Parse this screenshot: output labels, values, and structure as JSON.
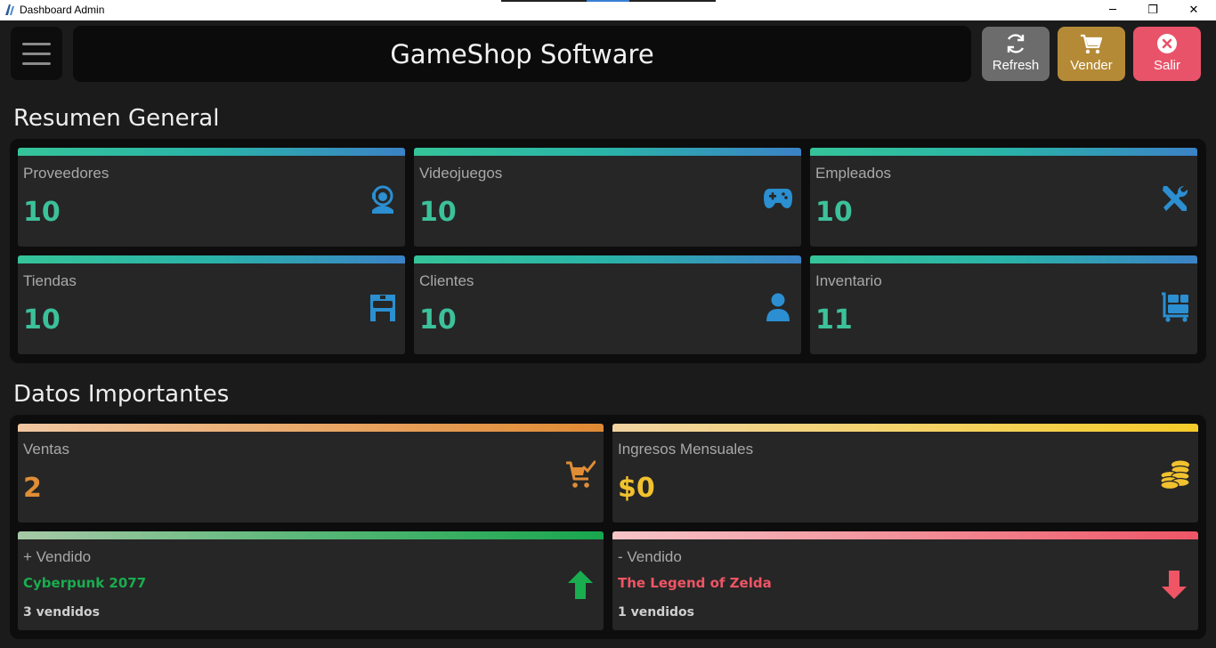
{
  "window": {
    "title": "Dashboard Admin",
    "controls": {
      "minimize": "─",
      "maximize": "❐",
      "close": "✕"
    }
  },
  "header": {
    "title": "GameShop Software",
    "buttons": {
      "refresh": {
        "label": "Refresh",
        "icon": "refresh-icon",
        "color": "#6c6c6c"
      },
      "vender": {
        "label": "Vender",
        "icon": "cart-icon",
        "color": "#b58a36"
      },
      "salir": {
        "label": "Salir",
        "icon": "close-circle-icon",
        "color": "#e9536a"
      }
    }
  },
  "resumen": {
    "title": "Resumen General",
    "cards": [
      {
        "label": "Proveedores",
        "value": "10",
        "icon": "support-agent-icon"
      },
      {
        "label": "Videojuegos",
        "value": "10",
        "icon": "gamepad-icon"
      },
      {
        "label": "Empleados",
        "value": "10",
        "icon": "tools-icon"
      },
      {
        "label": "Tiendas",
        "value": "10",
        "icon": "store-icon"
      },
      {
        "label": "Clientes",
        "value": "10",
        "icon": "user-icon"
      },
      {
        "label": "Inventario",
        "value": "11",
        "icon": "trolley-boxes-icon"
      }
    ]
  },
  "datos": {
    "title": "Datos Importantes",
    "ventas": {
      "label": "Ventas",
      "value": "2",
      "icon": "cart-check-icon",
      "color": "#e08d36"
    },
    "ingresos": {
      "label": "Ingresos Mensuales",
      "value": "$0",
      "icon": "coins-icon",
      "color": "#f2c12e"
    },
    "mas_vendido": {
      "label": "+ Vendido",
      "name": "Cyberpunk 2077",
      "count": "3 vendidos",
      "icon": "arrow-up-icon",
      "color": "#19ad4f"
    },
    "menos_vendido": {
      "label": "- Vendido",
      "name": "The Legend of Zelda",
      "count": "1 vendidos",
      "icon": "arrow-down-icon",
      "color": "#ef5565"
    }
  }
}
